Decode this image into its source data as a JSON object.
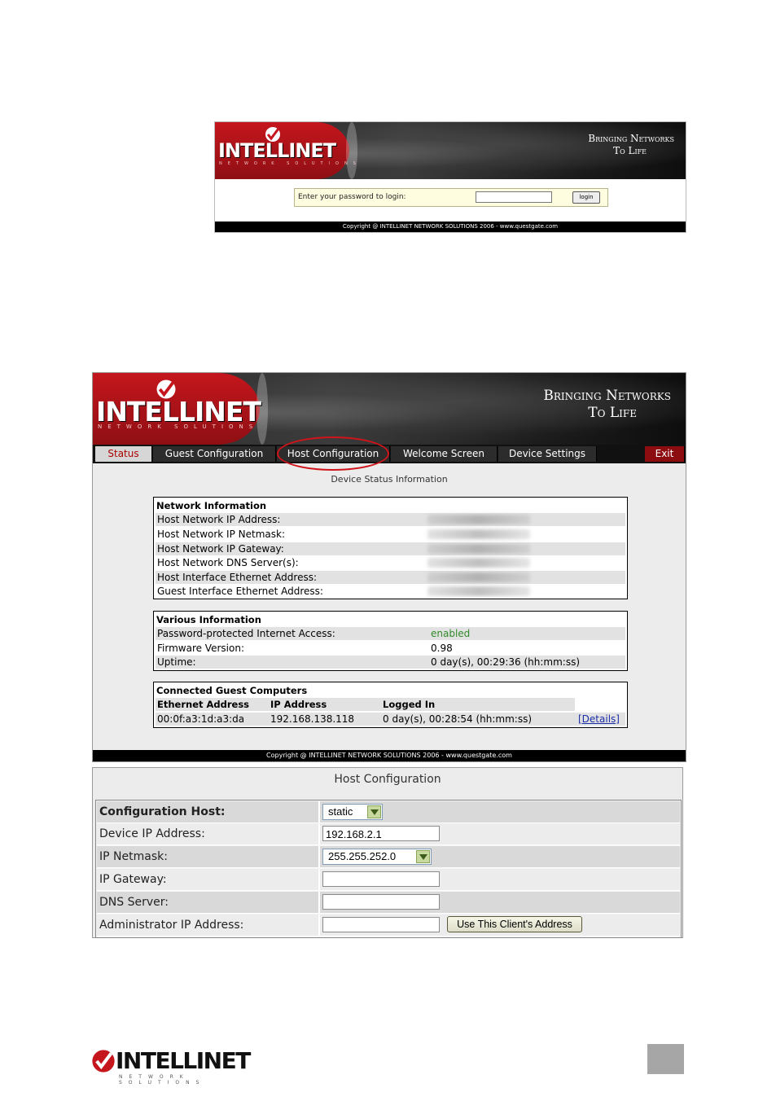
{
  "brand": {
    "logo_text": "INTELLINET",
    "logo_sub": "NETWORK SOLUTIONS",
    "tagline_line1": "Bringing Networks",
    "tagline_line2": "To Life"
  },
  "login": {
    "prompt": "Enter your password to login:",
    "password_value": "",
    "login_button": "login",
    "copyright": "Copyright @ INTELLINET NETWORK SOLUTIONS 2006 - www.questgate.com"
  },
  "status": {
    "tabs": [
      {
        "label": "Status"
      },
      {
        "label": "Guest Configuration"
      },
      {
        "label": "Host Configuration"
      },
      {
        "label": "Welcome Screen"
      },
      {
        "label": "Device Settings"
      },
      {
        "label": "Exit"
      }
    ],
    "page_title": "Device Status Information",
    "network": {
      "header": "Network Information",
      "rows": [
        {
          "key": "Host Network IP Address:"
        },
        {
          "key": "Host Network IP Netmask:"
        },
        {
          "key": "Host Network IP Gateway:"
        },
        {
          "key": "Host Network DNS Server(s):"
        },
        {
          "key": "Host Interface Ethernet Address:"
        },
        {
          "key": "Guest Interface Ethernet Address:"
        }
      ]
    },
    "various": {
      "header": "Various Information",
      "rows": [
        {
          "key": "Password-protected Internet Access:",
          "value": "enabled"
        },
        {
          "key": "Firmware Version:",
          "value": "0.98"
        },
        {
          "key": "Uptime:",
          "value": "0 day(s), 00:29:36 (hh:mm:ss)"
        }
      ]
    },
    "guests": {
      "header": "Connected Guest Computers",
      "columns": [
        "Ethernet Address",
        "IP Address",
        "Logged In"
      ],
      "rows": [
        {
          "ethernet": "00:0f:a3:1d:a3:da",
          "ip": "192.168.138.118",
          "logged_in": "0 day(s), 00:28:54 (hh:mm:ss)",
          "link": "[Details]"
        }
      ]
    },
    "copyright": "Copyright @ INTELLINET NETWORK SOLUTIONS 2006 - www.questgate.com"
  },
  "host_config": {
    "title": "Host Configuration",
    "configuration_host": {
      "label": "Configuration Host:",
      "value": "static"
    },
    "device_ip": {
      "label": "Device IP Address:",
      "value": "192.168.2.1"
    },
    "netmask": {
      "label": "IP Netmask:",
      "value": "255.255.252.0"
    },
    "gateway": {
      "label": "IP Gateway:",
      "value": ""
    },
    "dns": {
      "label": "DNS Server:",
      "value": ""
    },
    "admin_ip": {
      "label": "Administrator IP Address:",
      "value": "",
      "button": "Use This Client's Address"
    }
  },
  "colors": {
    "brand_red": "#c4161c",
    "circle_highlight": "#d0141a",
    "enabled_green": "#2f8a2a"
  }
}
